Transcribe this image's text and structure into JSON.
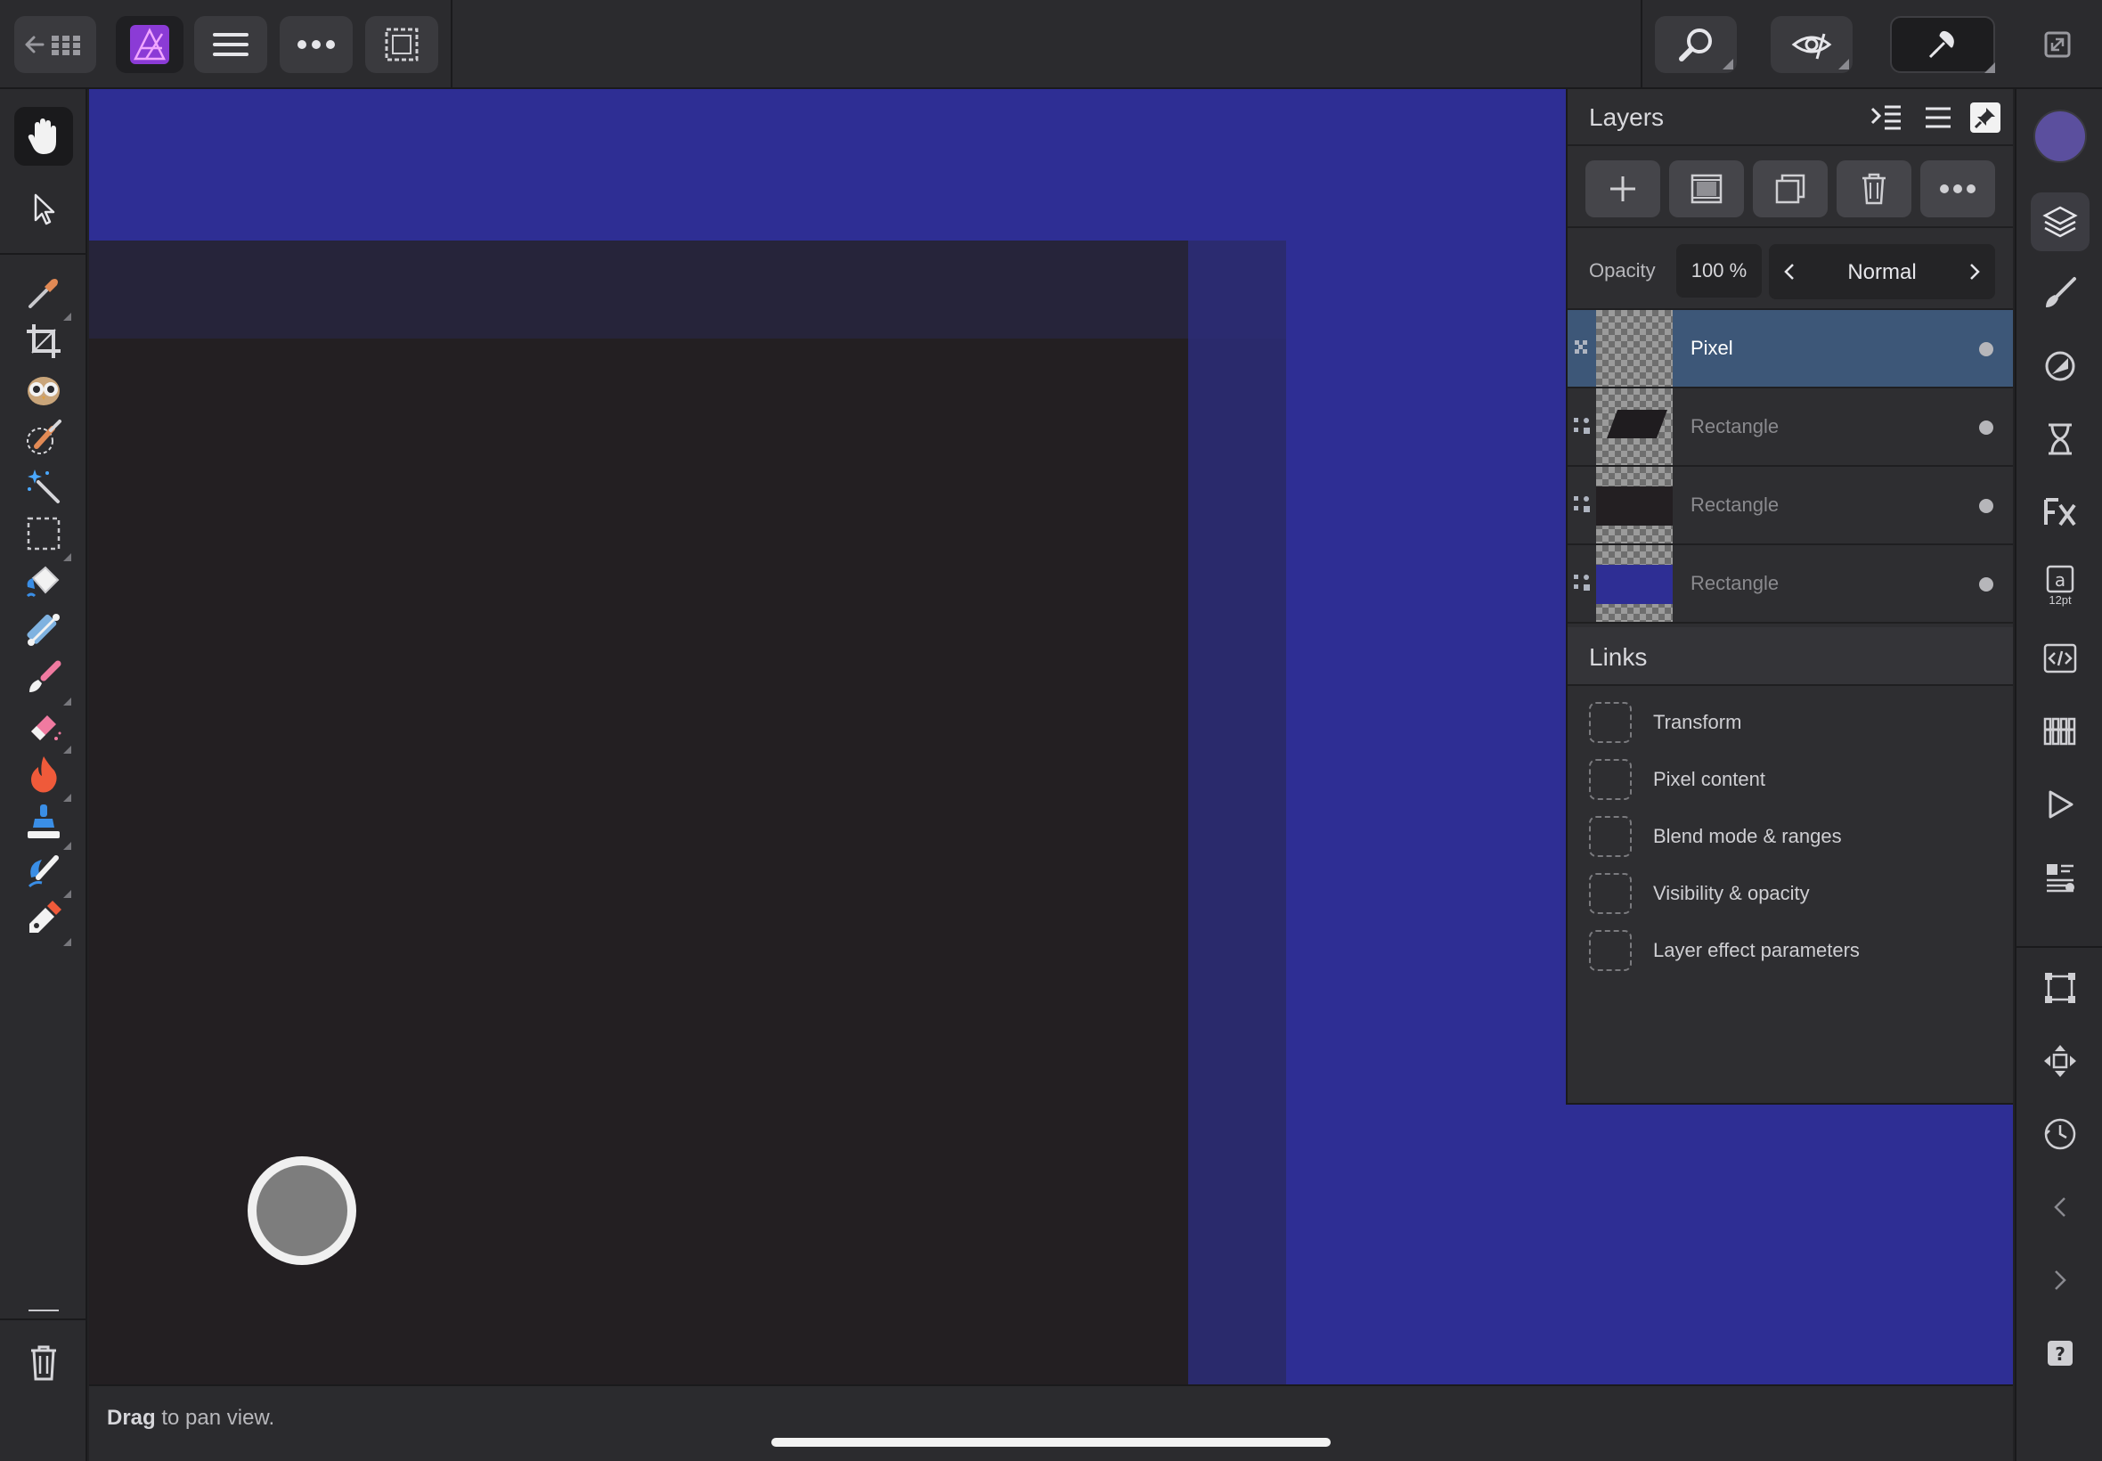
{
  "topbar": {
    "left_buttons": [
      "back-to-gallery-icon",
      "app-logo-icon",
      "menu-icon",
      "more-icon",
      "selection-icon"
    ],
    "right_buttons": [
      "zoom-icon",
      "view-quality-icon",
      "snapping-icon",
      "fullscreen-icon"
    ]
  },
  "left_tools": [
    "hand-icon",
    "move-icon",
    "color-picker-icon",
    "crop-icon",
    "red-eye-icon",
    "selection-brush-icon",
    "magic-wand-icon",
    "marquee-icon",
    "flood-fill-icon",
    "gradient-icon",
    "paint-brush-icon",
    "eraser-icon",
    "burn-icon",
    "clone-icon",
    "smudge-icon",
    "pen-icon",
    "delete-icon"
  ],
  "status": {
    "bold": "Drag",
    "rest": " to pan view."
  },
  "layers_panel": {
    "title": "Layers",
    "opacity_label": "Opacity",
    "opacity_value": "100 %",
    "blend_mode": "Normal",
    "layers": [
      {
        "name": "Pixel",
        "selected": true
      },
      {
        "name": "Rectangle",
        "selected": false
      },
      {
        "name": "Rectangle",
        "selected": false
      },
      {
        "name": "Rectangle",
        "selected": false
      }
    ],
    "links_title": "Links",
    "links": [
      "Transform",
      "Pixel content",
      "Blend mode & ranges",
      "Visibility & opacity",
      "Layer effect parameters"
    ]
  },
  "right_studio": {
    "color_swatch": "#5b4f9e",
    "text_size_label": "12pt",
    "items": [
      "color-icon",
      "layers-icon",
      "brushes-icon",
      "adjustments-icon",
      "filters-icon",
      "fx-icon",
      "text-styles-icon",
      "navigator-icon",
      "channels-icon",
      "history-play-icon",
      "stock-icon",
      "transform-icon",
      "move-snap-icon",
      "history-icon",
      "prev-icon",
      "next-icon",
      "help-icon"
    ]
  }
}
